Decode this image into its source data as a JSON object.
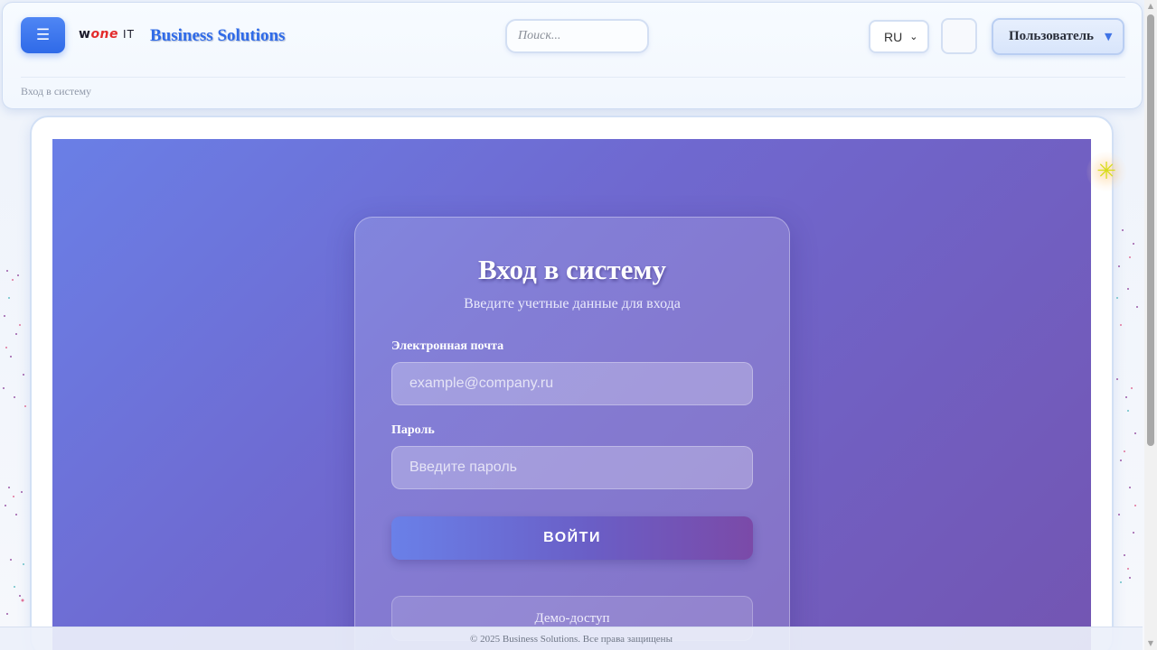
{
  "header": {
    "menu_icon": "☰",
    "logo": {
      "part1": "w",
      "part2": "one",
      "part3": "IT"
    },
    "brand": "Business Solutions",
    "search_placeholder": "Поиск...",
    "language": "RU",
    "icon_button_glyph": "",
    "user_label": "Пользователь",
    "user_caret": "▼",
    "breadcrumb": "Вход в систему"
  },
  "login": {
    "title": "Вход в систему",
    "subtitle": "Введите учетные данные для входа",
    "email_label": "Электронная почта",
    "email_placeholder": "example@company.ru",
    "password_label": "Пароль",
    "password_placeholder": "Введите пароль",
    "submit_label": "ВОЙТИ",
    "demo_label": "Демо-доступ"
  },
  "footer": {
    "copyright": "© 2025 Business Solutions. Все права защищены"
  },
  "colors": {
    "accent": "#2f6ae8",
    "hero_gradient_start": "#6a7fe6",
    "hero_gradient_end": "#7355b2",
    "logo_red": "#e32b2b"
  },
  "icons": {
    "menu": "hamburger-icon",
    "sparkle": "sparkle-icon",
    "caret": "chevron-down-icon"
  }
}
